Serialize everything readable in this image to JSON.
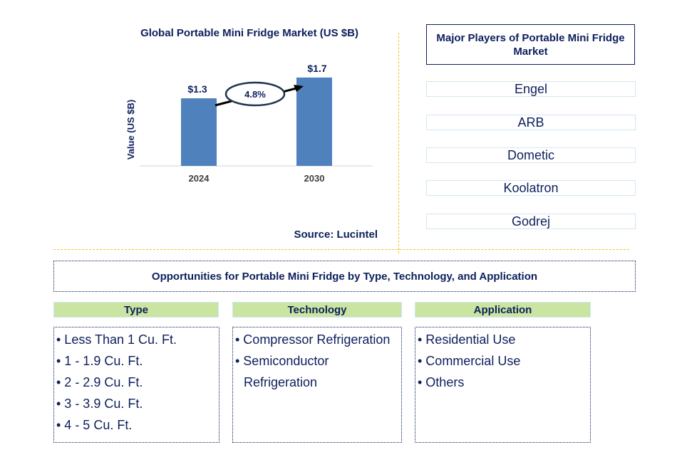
{
  "chart_data": {
    "type": "bar",
    "title": "Global Portable Mini Fridge Market (US $B)",
    "xlabel": "",
    "ylabel": "Value (US $B)",
    "categories": [
      "2024",
      "2030"
    ],
    "values": [
      1.3,
      1.7
    ],
    "data_labels": [
      "$1.3",
      "$1.7"
    ],
    "ylim": [
      0,
      1.9
    ],
    "grid": false,
    "bar_color": "#4f81bd",
    "annotation": {
      "type": "cagr-arrow",
      "text": "4.8%",
      "from": "2024",
      "to": "2030"
    }
  },
  "source": "Source: Lucintel",
  "players": {
    "title": "Major Players of Portable Mini Fridge Market",
    "items": [
      "Engel",
      "ARB",
      "Dometic",
      "Koolatron",
      "Godrej"
    ]
  },
  "opportunities": {
    "title": "Opportunities for Portable Mini Fridge by Type, Technology, and Application",
    "categories": [
      {
        "header": "Type",
        "items": [
          "• Less Than 1 Cu. Ft.",
          "• 1 - 1.9 Cu. Ft.",
          "• 2 - 2.9 Cu. Ft.",
          "• 3 - 3.9 Cu. Ft.",
          "• 4 - 5 Cu. Ft."
        ]
      },
      {
        "header": "Technology",
        "items": [
          "• Compressor Refrigeration",
          "• Semiconductor Refrigeration"
        ]
      },
      {
        "header": "Application",
        "items": [
          "• Residential Use",
          "• Commercial Use",
          "• Others"
        ]
      }
    ]
  },
  "colors": {
    "text": "#0d1f5c",
    "bar": "#4f81bd",
    "divider": "#f2c21a",
    "header_fill": "#c9e5a1",
    "player_border": "#d3e6f3"
  }
}
